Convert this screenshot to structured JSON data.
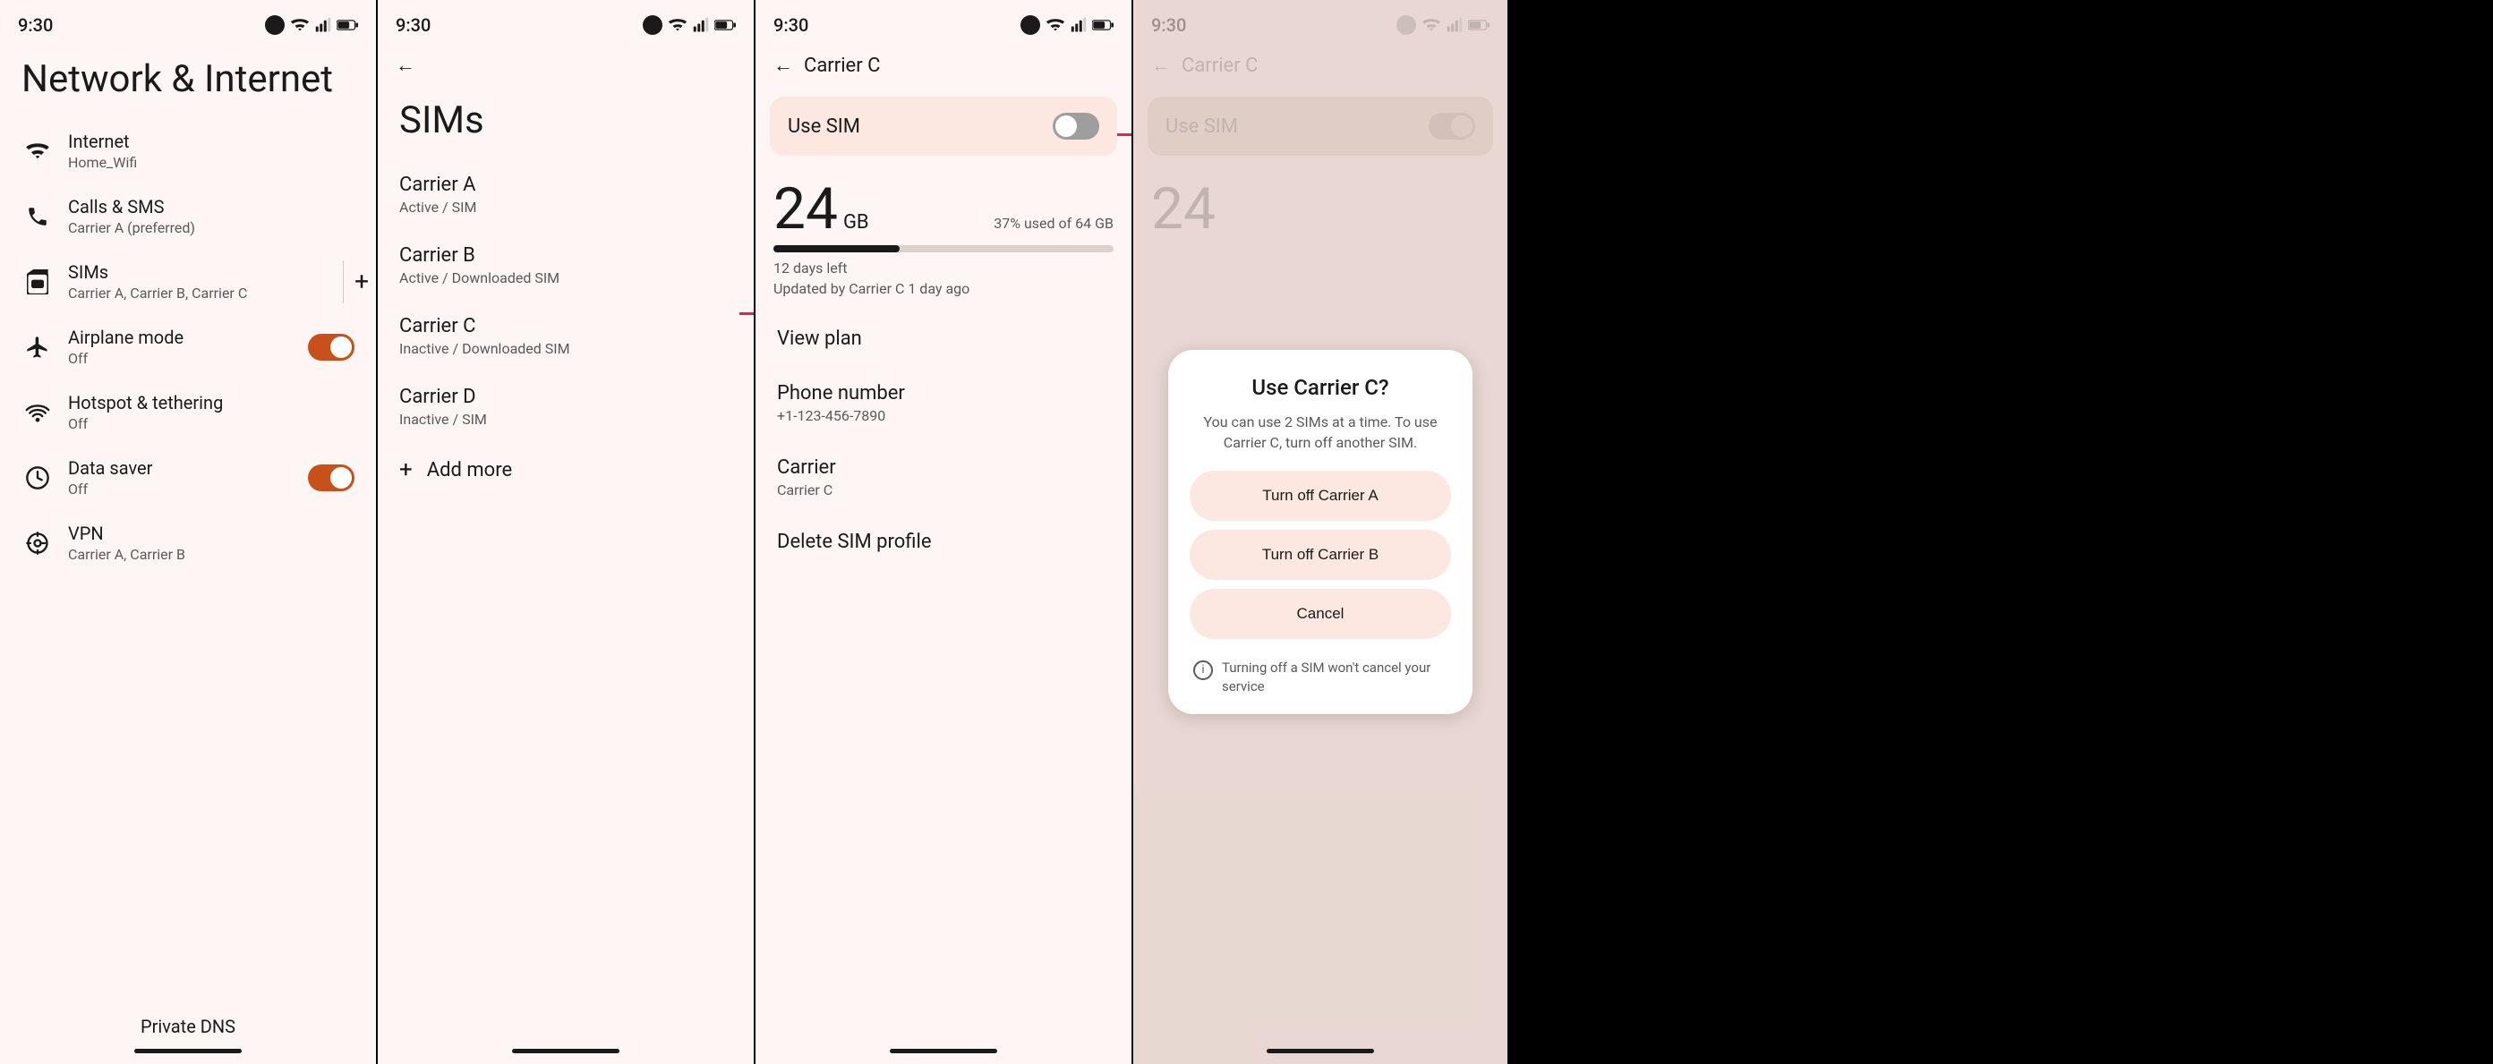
{
  "panel1": {
    "time": "9:30",
    "title": "Network & Internet",
    "items": [
      {
        "id": "internet",
        "label": "Internet",
        "sublabel": "Home_Wifi",
        "icon": "wifi"
      },
      {
        "id": "calls",
        "label": "Calls & SMS",
        "sublabel": "Carrier A (preferred)",
        "icon": "phone"
      },
      {
        "id": "sims",
        "label": "SIMs",
        "sublabel": "Carrier A, Carrier B, Carrier C",
        "icon": "sim"
      },
      {
        "id": "airplane",
        "label": "Airplane mode",
        "sublabel": "Off",
        "icon": "airplane",
        "toggle": true,
        "toggleState": "on"
      },
      {
        "id": "hotspot",
        "label": "Hotspot & tethering",
        "sublabel": "Off",
        "icon": "hotspot"
      },
      {
        "id": "datasaver",
        "label": "Data saver",
        "sublabel": "Off",
        "icon": "datasaver",
        "toggle": true,
        "toggleState": "on"
      },
      {
        "id": "vpn",
        "label": "VPN",
        "sublabel": "Carrier A, Carrier B",
        "icon": "vpn"
      }
    ],
    "bottom_label": "Private DNS"
  },
  "panel2": {
    "time": "9:30",
    "title": "SIMs",
    "sims": [
      {
        "name": "Carrier A",
        "status": "Active / SIM"
      },
      {
        "name": "Carrier B",
        "status": "Active / Downloaded SIM"
      },
      {
        "name": "Carrier C",
        "status": "Inactive / Downloaded SIM",
        "highlighted": true
      },
      {
        "name": "Carrier D",
        "status": "Inactive / SIM"
      }
    ],
    "add_more": "Add more"
  },
  "panel3": {
    "time": "9:30",
    "back_title": "Carrier C",
    "use_sim_label": "Use SIM",
    "data_amount": "24",
    "data_unit": "GB",
    "data_percent": "37% used of 64 GB",
    "progress_pct": 37,
    "days_left": "12 days left",
    "updated": "Updated by Carrier C 1 day ago",
    "items": [
      {
        "label": "View plan",
        "value": ""
      },
      {
        "label": "Phone number",
        "value": "+1-123-456-7890"
      },
      {
        "label": "Carrier",
        "value": "Carrier C"
      },
      {
        "label": "Delete SIM profile",
        "value": ""
      }
    ]
  },
  "panel4": {
    "time": "9:30",
    "back_title": "Carrier C",
    "use_sim_label": "Use SIM",
    "data_amount": "24",
    "dialog": {
      "title": "Use Carrier C?",
      "description": "You can use 2 SIMs at a time. To use Carrier C, turn off another SIM.",
      "btn1": "Turn off Carrier A",
      "btn2": "Turn off Carrier B",
      "btn3": "Cancel",
      "info_text": "Turning off a SIM won't cancel your service"
    }
  }
}
